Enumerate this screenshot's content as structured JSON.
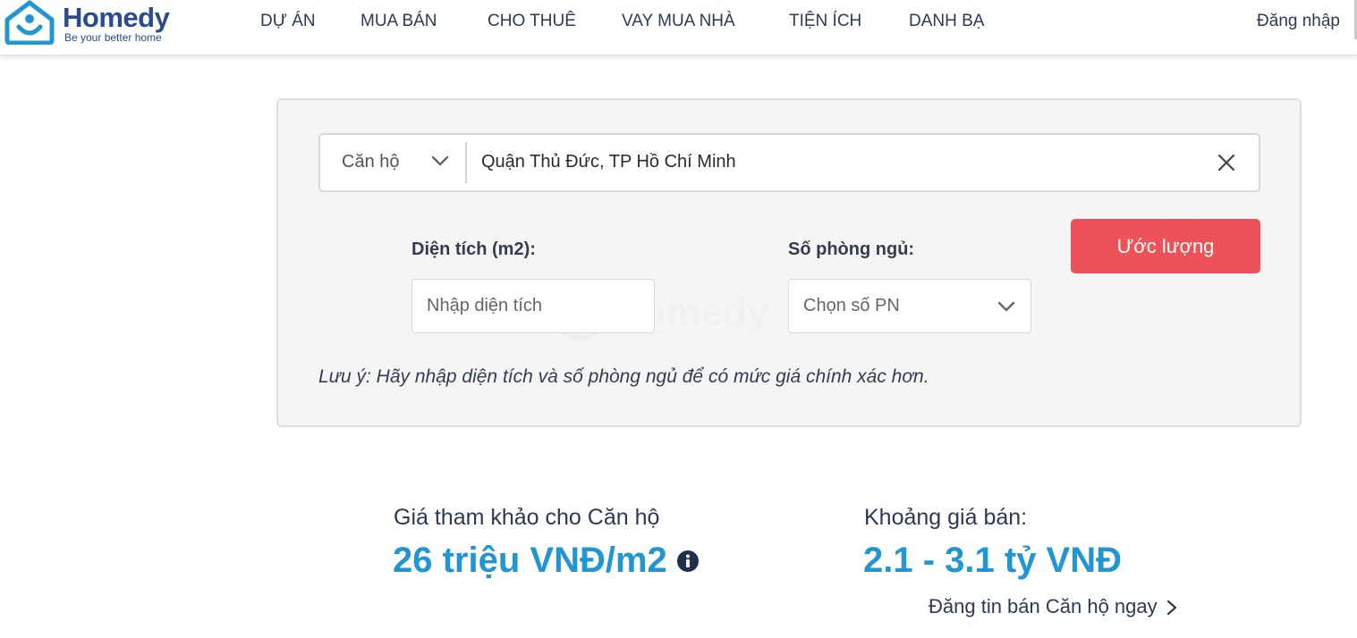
{
  "header": {
    "logo": {
      "name": "Homedy",
      "tagline": "Be your better home"
    },
    "nav": [
      {
        "label": "DỰ ÁN"
      },
      {
        "label": "MUA BÁN"
      },
      {
        "label": "CHO THUÊ"
      },
      {
        "label": "VAY MUA NHÀ"
      },
      {
        "label": "TIỆN ÍCH"
      },
      {
        "label": "DANH BẠ"
      }
    ],
    "login_label": "Đăng nhập"
  },
  "estimator": {
    "property_type": "Căn hộ",
    "location": "Quận Thủ Đức, TP Hồ Chí Minh",
    "area_label": "Diện tích (m2):",
    "area_placeholder": "Nhập diện tích",
    "bedrooms_label": "Số phòng ngủ:",
    "bedrooms_placeholder": "Chọn số PN",
    "estimate_button": "Ước lượng",
    "note": "Lưu ý: Hãy nhập diện tích và số phòng ngủ để có mức giá chính xác hơn."
  },
  "results": {
    "reference_label": "Giá tham khảo cho Căn hộ",
    "reference_value": "26 triệu VNĐ/m2",
    "range_label": "Khoảng giá bán:",
    "range_value": "2.1 - 3.1 tỷ VNĐ",
    "post_link": "Đăng tin bán Căn hộ ngay"
  },
  "colors": {
    "brand_dark": "#2a4c8c",
    "brand_blue": "#2196d3",
    "button_red": "#ec5257",
    "text_dark": "#2b3a55"
  },
  "icons": [
    "homedy-logo-icon",
    "chevron-down-icon",
    "close-icon",
    "info-icon",
    "chevron-right-icon"
  ]
}
